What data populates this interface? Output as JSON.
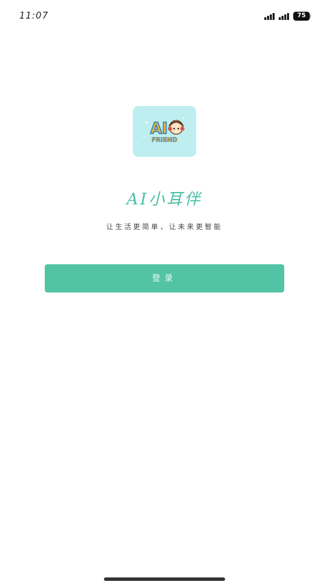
{
  "status_bar": {
    "time": "11:07",
    "battery": "75"
  },
  "logo": {
    "main_text": "AI",
    "sub_text": "FRIEND"
  },
  "app": {
    "title": "AI小耳伴",
    "slogan": "让生活更简单，让未来更智能"
  },
  "login": {
    "button_label": "登录"
  },
  "colors": {
    "accent": "#52c3a4",
    "title": "#4bbfa4",
    "logo_background": "#bfeef0"
  }
}
